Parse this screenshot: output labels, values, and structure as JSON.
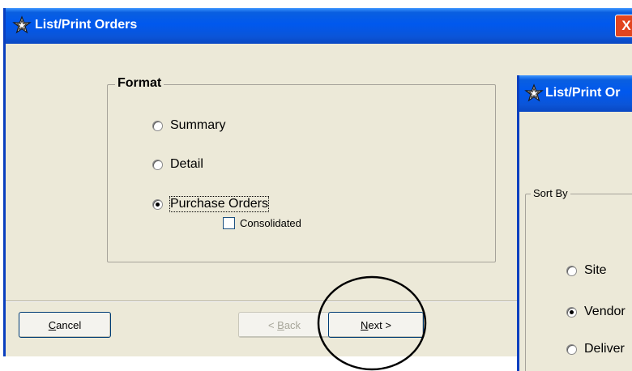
{
  "main_window": {
    "title": "List/Print Orders",
    "close_label": "X",
    "format_group": {
      "legend": "Format",
      "options": [
        {
          "label": "Summary",
          "selected": false
        },
        {
          "label": "Detail",
          "selected": false
        },
        {
          "label": "Purchase Orders",
          "selected": true
        }
      ],
      "consolidated": {
        "label": "Consolidated",
        "checked": false
      }
    },
    "buttons": {
      "cancel_pre": "",
      "cancel_key": "C",
      "cancel_post": "ancel",
      "back_pre": "< ",
      "back_key": "B",
      "back_post": "ack",
      "next_pre": "",
      "next_key": "N",
      "next_post": "ext >"
    }
  },
  "second_window": {
    "title": "List/Print Or",
    "sort_group": {
      "legend": "Sort By",
      "options": [
        {
          "label": "Site",
          "selected": false
        },
        {
          "label": "Vendor",
          "selected": true
        },
        {
          "label": "Deliver",
          "selected": false
        }
      ]
    }
  },
  "colors": {
    "title_bar": "#0058ee",
    "dialog_bg": "#ece9d8",
    "close_button": "#e2451f",
    "highlight_circle": "#000000"
  }
}
